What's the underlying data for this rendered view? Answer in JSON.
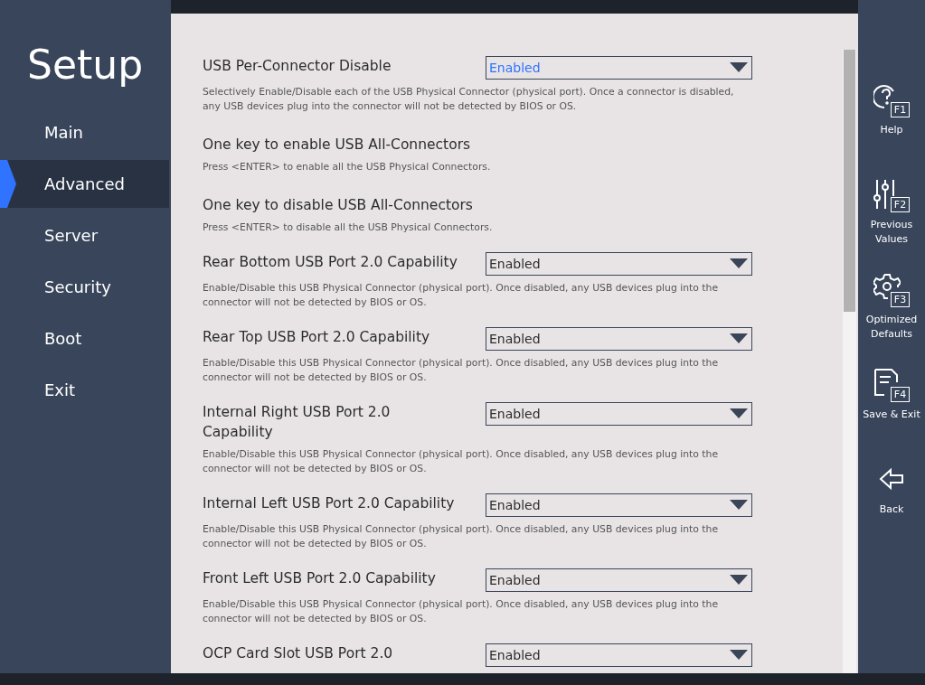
{
  "sidebar": {
    "title": "Setup",
    "items": [
      {
        "label": "Main",
        "selected": false
      },
      {
        "label": "Advanced",
        "selected": true
      },
      {
        "label": "Server",
        "selected": false
      },
      {
        "label": "Security",
        "selected": false
      },
      {
        "label": "Boot",
        "selected": false
      },
      {
        "label": "Exit",
        "selected": false
      }
    ]
  },
  "settings": [
    {
      "kind": "dropdown",
      "label": "USB Per-Connector Disable",
      "value": "Enabled",
      "focused": true,
      "description": "Selectively Enable/Disable each of the USB Physical Connector (physical port).  Once a connector is disabled, any USB devices plug into the connector will not be detected by BIOS or OS."
    },
    {
      "kind": "action",
      "label": "One key to enable USB All-Connectors",
      "focused": false,
      "description": "Press <ENTER> to enable all the USB Physical Connectors."
    },
    {
      "kind": "action",
      "label": "One key to disable USB All-Connectors",
      "focused": false,
      "description": "Press <ENTER> to disable all the USB Physical Connectors."
    },
    {
      "kind": "dropdown",
      "label": "Rear Bottom USB Port 2.0 Capability",
      "value": "Enabled",
      "focused": false,
      "description": "Enable/Disable this USB Physical Connector (physical port).  Once disabled, any USB devices plug into the connector will not be detected by BIOS or OS."
    },
    {
      "kind": "dropdown",
      "label": "Rear Top USB Port 2.0 Capability",
      "value": "Enabled",
      "focused": false,
      "description": "Enable/Disable this USB Physical Connector (physical port).  Once disabled, any USB devices plug into the connector will not be detected by BIOS or OS."
    },
    {
      "kind": "dropdown",
      "label": "Internal Right USB Port 2.0 Capability",
      "value": "Enabled",
      "focused": false,
      "description": "Enable/Disable this USB Physical Connector (physical port).  Once disabled, any USB devices plug into the connector will not be detected by BIOS or OS."
    },
    {
      "kind": "dropdown",
      "label": "Internal Left USB Port 2.0 Capability",
      "value": "Enabled",
      "focused": false,
      "description": "Enable/Disable this USB Physical Connector (physical port).  Once disabled, any USB devices plug into the connector will not be detected by BIOS or OS."
    },
    {
      "kind": "dropdown",
      "label": "Front Left USB Port 2.0 Capability",
      "value": "Enabled",
      "focused": false,
      "description": "Enable/Disable this USB Physical Connector (physical port).  Once disabled, any USB devices plug into the connector will not be detected by BIOS or OS."
    },
    {
      "kind": "dropdown",
      "label": "OCP Card Slot USB Port 2.0",
      "value": "Enabled",
      "focused": false
    }
  ],
  "actions": [
    {
      "kind": "help",
      "key": "F1",
      "label": "Help"
    },
    {
      "kind": "previous",
      "key": "F2",
      "label": "Previous Values"
    },
    {
      "kind": "defaults",
      "key": "F3",
      "label": "Optimized Defaults"
    },
    {
      "kind": "save",
      "key": "F4",
      "label": "Save & Exit"
    },
    {
      "kind": "back",
      "label": "Back"
    }
  ]
}
